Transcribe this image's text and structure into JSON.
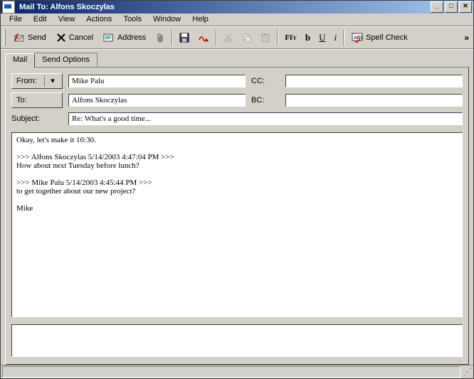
{
  "window": {
    "title": "Mail To: Alfons Skoczylas"
  },
  "menu": {
    "file": "File",
    "edit": "Edit",
    "view": "View",
    "actions": "Actions",
    "tools": "Tools",
    "window": "Window",
    "help": "Help"
  },
  "toolbar": {
    "send": "Send",
    "cancel": "Cancel",
    "address": "Address",
    "spellcheck": "Spell Check"
  },
  "tabs": {
    "mail": "Mail",
    "send_options": "Send Options"
  },
  "header": {
    "from_label": "From:",
    "from_value": "Mike Palu",
    "cc_label": "CC:",
    "cc_value": "",
    "to_label": "To:",
    "to_value": "Alfons Skoczylas",
    "bc_label": "BC:",
    "bc_value": "",
    "subject_label": "Subject:",
    "subject_value": "Re: What's a good time..."
  },
  "body": {
    "text": "Okay, let's make it 10:30.\n\n>>> Alfons Skoczylas 5/14/2003 4:47:04 PM >>>\nHow about next Tuesday before lunch?\n\n>>> Mike Palu 5/14/2003 4:45:44 PM >>>\nto get together about our new project?\n\nMike"
  }
}
